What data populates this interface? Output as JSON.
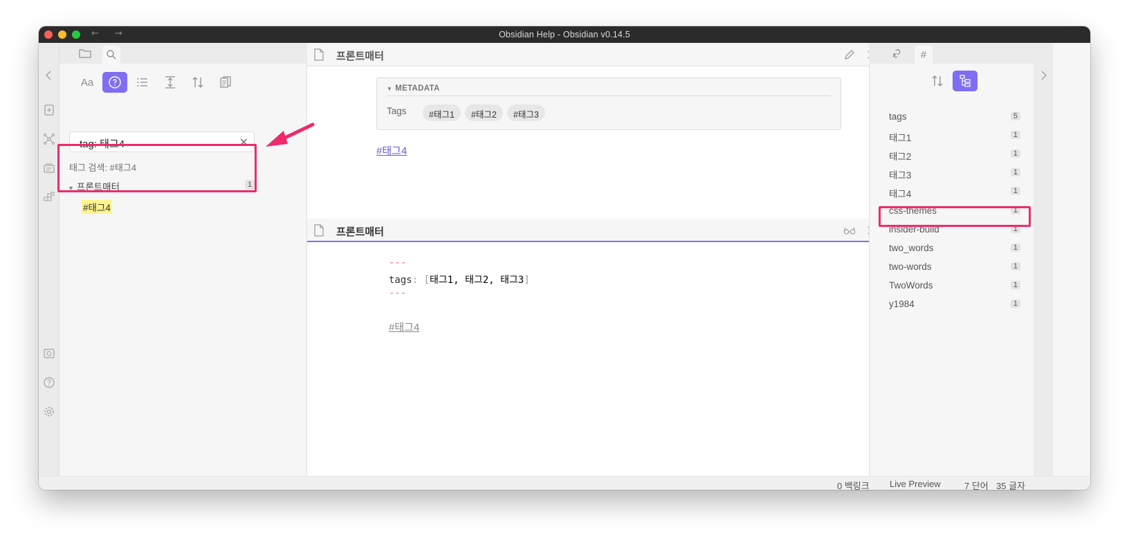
{
  "window": {
    "title": "Obsidian Help - Obsidian v0.14.5",
    "back_icon": "←",
    "forward_icon": "→"
  },
  "left_sidebar": {
    "search": {
      "query": "tag: 태그4",
      "clear_icon": "✕",
      "info": "태그 검색: #태그4"
    },
    "result": {
      "file": "프론트매터",
      "count": "1",
      "match": "#태그4"
    },
    "tools": {
      "match_case": "Aa"
    }
  },
  "editor_top": {
    "title": "프론트매터",
    "metadata_header": "METADATA",
    "tags_key": "Tags",
    "tags": [
      "#태그1",
      "#태그2",
      "#태그3"
    ],
    "link": "#태그4"
  },
  "editor_bottom": {
    "title": "프론트매터",
    "line1": "---",
    "key": "tags",
    "colon": ":",
    "open_bracket": "[",
    "values": "태그1, 태그2, 태그3",
    "close_bracket": "]",
    "line3": "---",
    "link": "#태그4"
  },
  "right_sidebar": {
    "tags": [
      {
        "name": "tags",
        "count": "5"
      },
      {
        "name": "태그1",
        "count": "1"
      },
      {
        "name": "태그2",
        "count": "1"
      },
      {
        "name": "태그3",
        "count": "1"
      },
      {
        "name": "태그4",
        "count": "1"
      },
      {
        "name": "css-themes",
        "count": "1"
      },
      {
        "name": "insider-build",
        "count": "1"
      },
      {
        "name": "two_words",
        "count": "1"
      },
      {
        "name": "two-words",
        "count": "1"
      },
      {
        "name": "TwoWords",
        "count": "1"
      },
      {
        "name": "y1984",
        "count": "1"
      }
    ],
    "hash_tab": "#"
  },
  "status_bar": {
    "backlinks": "0 백링크",
    "mode": "Live Preview",
    "words": "7 단어",
    "chars": "35 글자"
  },
  "colors": {
    "accent": "#7f6df2",
    "highlight_box": "#ee2a6b",
    "search_match": "#fff48e"
  }
}
